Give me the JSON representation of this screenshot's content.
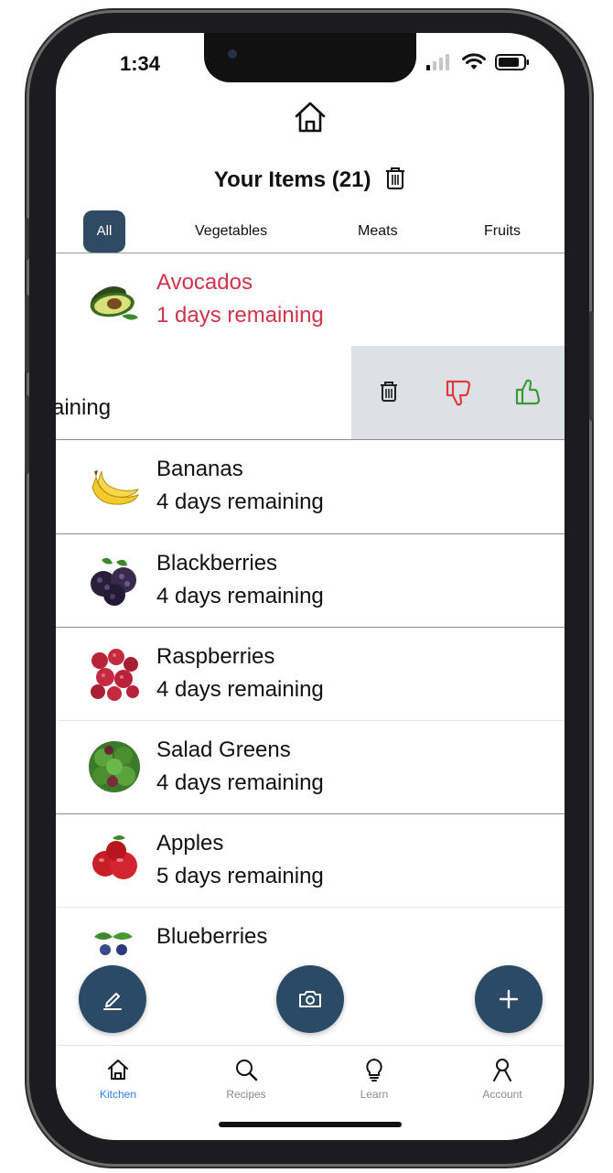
{
  "status": {
    "time": "1:34"
  },
  "header": {
    "title": "Your Items (21)"
  },
  "tabs": [
    {
      "label": "All",
      "active": true
    },
    {
      "label": "Vegetables",
      "active": false
    },
    {
      "label": "Meats",
      "active": false
    },
    {
      "label": "Fruits",
      "active": false
    }
  ],
  "items": [
    {
      "name": "Avocados",
      "days": "1 days remaining",
      "image": "avocado-image",
      "expiring": true
    },
    {
      "name": "Bananas",
      "days": "4 days remaining",
      "image": "banana-image"
    },
    {
      "name": "Blackberries",
      "days": "4 days remaining",
      "image": "blackberry-image"
    },
    {
      "name": "Raspberries",
      "days": "4 days remaining",
      "image": "raspberry-image"
    },
    {
      "name": "Salad Greens",
      "days": "4 days remaining",
      "image": "salad-greens-image"
    },
    {
      "name": "Apples",
      "days": "5 days remaining",
      "image": "apple-image"
    },
    {
      "name": "Blueberries",
      "days": "",
      "image": "blueberry-image"
    }
  ],
  "swiped_item": {
    "partial_text": "aining",
    "actions": [
      "trash-icon",
      "thumbs-down-icon",
      "thumbs-up-icon"
    ]
  },
  "fabs": [
    "pencil-icon",
    "camera-icon",
    "plus-icon"
  ],
  "nav": [
    {
      "label": "Kitchen",
      "icon": "home-icon",
      "active": true
    },
    {
      "label": "Recipes",
      "icon": "search-icon",
      "active": false
    },
    {
      "label": "Learn",
      "icon": "lightbulb-icon",
      "active": false
    },
    {
      "label": "Account",
      "icon": "person-icon",
      "active": false
    }
  ],
  "colors": {
    "accent": "#2b4a66",
    "expiring": "#d0344a",
    "nav_active": "#2f7fe0",
    "thumbs_down": "#e03a3a",
    "thumbs_up": "#3a9a3a"
  }
}
